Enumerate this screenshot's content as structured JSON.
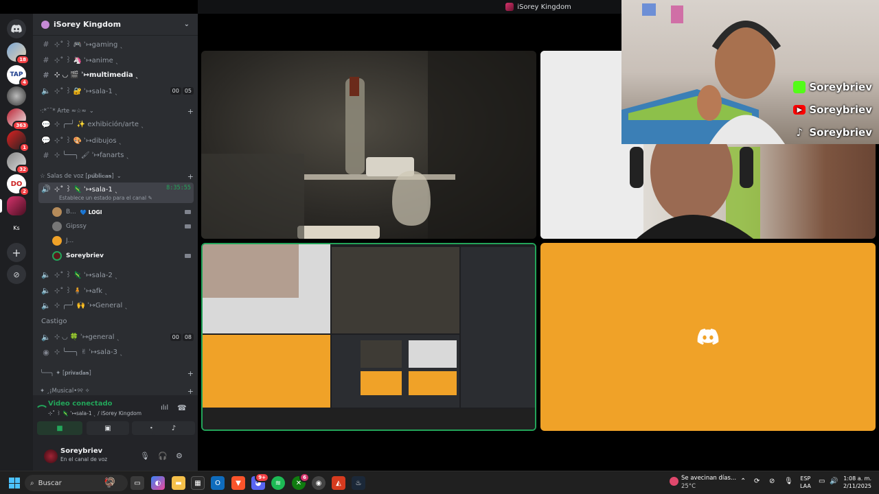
{
  "window": {
    "title": "iSorey Kingdom"
  },
  "server": {
    "name": "iSorey Kingdom"
  },
  "rail": {
    "badges": [
      "18",
      "4",
      "363",
      "1",
      "32",
      "2"
    ],
    "initials": "Ks"
  },
  "channels": [
    {
      "name": "⊹˚ ꒱ 🎮 ʾ↦gaming ˎ",
      "kind": "text"
    },
    {
      "name": "⊹˚ ꒱ 🦄 ʾ↦anime ˎ",
      "kind": "text"
    },
    {
      "name": "⊹ ◟◞ 🎬 ʾ↦multimedia ˎ",
      "kind": "text"
    },
    {
      "name": "⊹˚ ꒱ 🔐 ʾ↦sala-1 ˎ",
      "kind": "voice",
      "counts": [
        "00",
        "05"
      ]
    }
  ],
  "categories": {
    "arte": "·:*¨¨* Arte ≈☆≈",
    "voz": "☆ Salas de voz [𝐩𝐮́𝐛𝐥𝐢𝐜𝐚𝐬]",
    "privadas": "╰──╮ ✦ [𝐩𝐫𝐢𝐯𝐚𝐝𝐚𝐬]",
    "musical": "✦ ¸¡Musical•୨୧ ✧"
  },
  "arte_channels": [
    {
      "name": "⊹ ╭─╯ ✨ exhibición/arte ˎ"
    },
    {
      "name": "⊹˚ ꒱ 🎨 ʾ↦dibujos ˎ"
    },
    {
      "name": "⊹ ╰──╮ 🖌 ʾ↦fanarts ˎ"
    }
  ],
  "voice_channels": {
    "active": {
      "name": "⊹˚ ꒱ 🦎 ʾ↦sala-1 ˎ",
      "timer": "8:35:55",
      "status": "Establece un estado para el canal ✎"
    },
    "users": [
      {
        "name": "B...",
        "tag": "💙 LOGI"
      },
      {
        "name": "Gipssy",
        "tag": ""
      },
      {
        "name": "J...",
        "tag": ""
      },
      {
        "name": "Soreybriev",
        "tag": ""
      }
    ],
    "others": [
      {
        "name": "⊹˚ ꒱ 🦎 ʾ↦sala-2 ˎ"
      },
      {
        "name": "⊹˚ ꒱ 🧍 ʾ↦afk ˎ"
      },
      {
        "name": "⊹ ╭─╯ 🙌 ʾ↦General ˎ"
      },
      {
        "name": "Castigo"
      },
      {
        "name": "⊹ ◟◞ 🍀 ʾ↦general ˎ",
        "counts": [
          "00",
          "08"
        ]
      },
      {
        "name": "⊹ ╰──╮ ✌ ʾ↦sala-3 ˎ"
      }
    ]
  },
  "voice_panel": {
    "status": "Video conectado",
    "channel": "⊹˚ ꒱ 🦎 ʾ↦sala-1 ˎ / iSorey Kingdom"
  },
  "user": {
    "name": "Soreybriev",
    "status": "En el canal de voz"
  },
  "overlay": {
    "socials": [
      {
        "name": "Soreybriev",
        "icon": "kick-icon",
        "color": "#53fc18"
      },
      {
        "name": "Soreybriev",
        "icon": "youtube-icon",
        "color": "#ff0000"
      },
      {
        "name": "Soreybriev",
        "icon": "tiktok-icon",
        "color": "#000000"
      }
    ]
  },
  "taskbar": {
    "search_placeholder": "Buscar",
    "discord_badge": "9+",
    "xbox_badge": "6",
    "weather_text": "Se avecinan días...",
    "weather_temp": "25°C",
    "lang_1": "ESP",
    "lang_2": "LAA",
    "time": "1:08 a. m.",
    "date": "2/11/2025"
  },
  "colors": {
    "accent_green": "#23a55a",
    "avatar_tile": "#f0a228",
    "sidebar": "#2b2d31",
    "rail": "#1e1f22"
  }
}
